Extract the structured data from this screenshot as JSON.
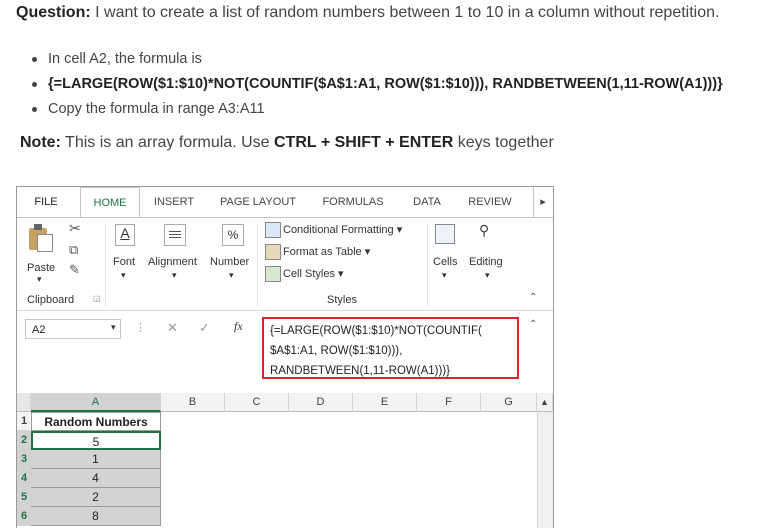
{
  "question": {
    "prefix": "Question:",
    "text": " I want to create a list of random numbers between 1 to 10 in a column without repetition."
  },
  "bullets": [
    "In cell A2, the formula is",
    "{=LARGE(ROW($1:$10)*NOT(COUNTIF($A$1:A1, ROW($1:$10))), RANDBETWEEN(1,11-ROW(A1)))}",
    "Copy the formula in range A3:A11"
  ],
  "note": {
    "prefix": "Note:",
    "text1": " This is an array formula. Use ",
    "keys": "CTRL + SHIFT + ENTER",
    "text2": " keys together"
  },
  "excel": {
    "tabs": [
      "FILE",
      "HOME",
      "INSERT",
      "PAGE LAYOUT",
      "FORMULAS",
      "DATA",
      "REVIEW"
    ],
    "more_tabs": "▸",
    "ribbon": {
      "paste": "Paste",
      "font": "Font",
      "alignment": "Alignment",
      "number": "Number",
      "cond_format": "Conditional Formatting",
      "format_table": "Format as Table",
      "cell_styles": "Cell Styles",
      "cells": "Cells",
      "editing": "Editing",
      "clipboard": "Clipboard",
      "styles": "Styles",
      "percent": "%",
      "font_letter": "A"
    },
    "name_box": "A2",
    "fx": "fx",
    "formula_lines": [
      "{=LARGE(ROW($1:$10)*NOT(COUNTIF(",
      "$A$1:A1, ROW($1:$10))),",
      "RANDBETWEEN(1,11-ROW(A1)))}"
    ],
    "columns": [
      "A",
      "B",
      "C",
      "D",
      "E",
      "F",
      "G"
    ],
    "rows": [
      "1",
      "2",
      "3",
      "4",
      "5",
      "6"
    ],
    "header_cell": "Random Numbers",
    "values": [
      "5",
      "1",
      "4",
      "2",
      "8"
    ],
    "accent": "#217346",
    "highlight": "#d9242b"
  }
}
